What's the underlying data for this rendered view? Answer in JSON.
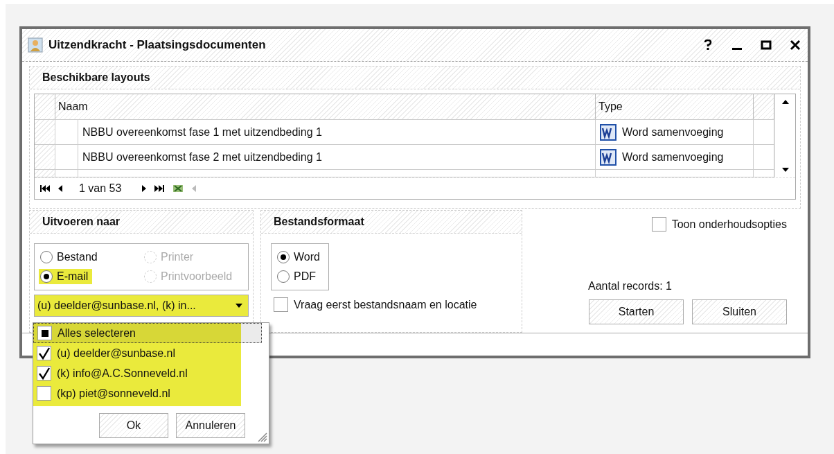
{
  "window": {
    "title": "Uitzendkracht - Plaatsingsdocumenten"
  },
  "layouts": {
    "title": "Beschikbare layouts",
    "columns": [
      "Naam",
      "Type"
    ],
    "rows": [
      {
        "name": "NBBU overeenkomst fase 1 met uitzendbeding 1",
        "type": "Word samenvoeging"
      },
      {
        "name": "NBBU overeenkomst fase 2 met uitzendbeding 1",
        "type": "Word samenvoeging"
      }
    ],
    "pager": "1 van 53"
  },
  "output": {
    "title": "Uitvoeren naar",
    "options": [
      {
        "label": "Bestand",
        "selected": false,
        "disabled": false,
        "highlighted": false
      },
      {
        "label": "Printer",
        "selected": false,
        "disabled": true,
        "highlighted": false
      },
      {
        "label": "E-mail",
        "selected": true,
        "disabled": false,
        "highlighted": true
      },
      {
        "label": "Printvoorbeeld",
        "selected": false,
        "disabled": true,
        "highlighted": false
      }
    ],
    "recipients": {
      "value": "(u) deelder@sunbase.nl, (k) in...",
      "highlighted": true
    }
  },
  "format": {
    "title": "Bestandsformaat",
    "options": [
      {
        "label": "Word",
        "selected": true
      },
      {
        "label": "PDF",
        "selected": false
      }
    ],
    "ask_filename": {
      "label": "Vraag eerst bestandsnaam en locatie",
      "checked": false
    }
  },
  "maintenance": {
    "label": "Toon onderhoudsopties",
    "checked": false
  },
  "records": "Aantal records: 1",
  "buttons": [
    "Starten",
    "Sluiten"
  ],
  "popup": {
    "select_all": {
      "label": "Alles selecteren",
      "mixed": true
    },
    "items": [
      {
        "label": "(u) deelder@sunbase.nl",
        "checked": true
      },
      {
        "label": "(k) info@A.C.Sonneveld.nl",
        "checked": true
      },
      {
        "label": "(kp) piet@sonneveld.nl",
        "checked": false
      }
    ],
    "highlighted": true,
    "buttons": [
      "Ok",
      "Annuleren"
    ]
  }
}
